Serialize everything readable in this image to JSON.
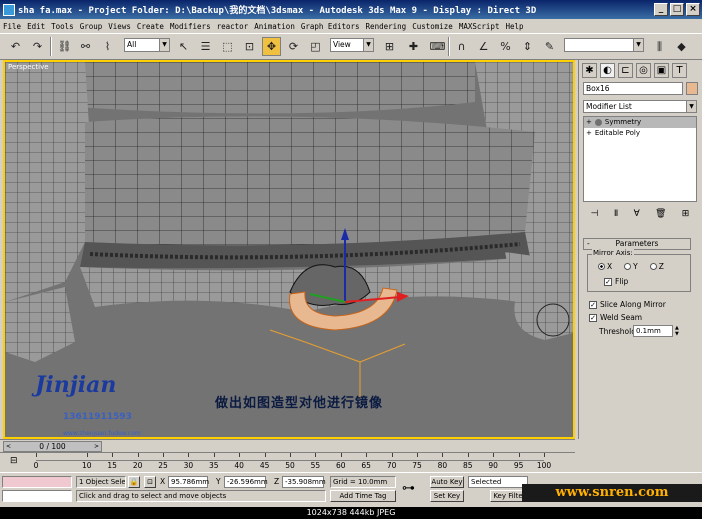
{
  "window": {
    "title": "sha fa.max    - Project Folder: D:\\Backup\\我的文档\\3dsmax    - Autodesk 3ds Max 9    - Display : Direct 3D"
  },
  "menu": [
    "File",
    "Edit",
    "Tools",
    "Group",
    "Views",
    "Create",
    "Modifiers",
    "reactor",
    "Animation",
    "Graph Editors",
    "Rendering",
    "Customize",
    "MAXScript",
    "Help"
  ],
  "toolbar": {
    "selection_filter": "All",
    "ref_coord": "View"
  },
  "viewport": {
    "label": "Perspective",
    "overlay_text": "做出如图造型对他进行镜像",
    "logo_text": "Jinjian",
    "logo_phone": "13611911593",
    "logo_url": "www.zhenjuan.fudew.com"
  },
  "command_panel": {
    "object_name": "Box16",
    "object_color": "#e8b890",
    "modifier_list_label": "Modifier List",
    "stack": [
      {
        "label": "Symmetry",
        "selected": true
      },
      {
        "label": "Editable Poly",
        "selected": false
      }
    ],
    "rollout_title": "Parameters",
    "mirror_axis_label": "Mirror Axis:",
    "axes": [
      {
        "label": "X",
        "checked": true
      },
      {
        "label": "Y",
        "checked": false
      },
      {
        "label": "Z",
        "checked": false
      }
    ],
    "flip_label": "Flip",
    "flip_checked": true,
    "slice_label": "Slice Along Mirror",
    "slice_checked": true,
    "weld_label": "Weld Seam",
    "weld_checked": true,
    "threshold_label": "Threshold:",
    "threshold_value": "0.1mm"
  },
  "timeline": {
    "frame_display": "0 / 100",
    "ticks": [
      "0",
      "10",
      "15",
      "20",
      "25",
      "30",
      "35",
      "40",
      "45",
      "50",
      "55",
      "60",
      "65",
      "70",
      "75",
      "80",
      "85",
      "90",
      "95",
      "100"
    ]
  },
  "status": {
    "selection_count": "1 Object Sele",
    "prompt": "Click and drag to select and move objects",
    "x_label": "X",
    "x_value": "95.786mm",
    "y_label": "Y",
    "y_value": "-26.596mm",
    "z_label": "Z",
    "z_value": "-35.908mm",
    "grid": "Grid = 10.0mm",
    "add_time_tag": "Add Time Tag",
    "auto_key": "Auto Key",
    "set_key": "Set Key",
    "key_mode": "Selected",
    "key_filters": "Key Filte"
  },
  "banner": "www.snren.com",
  "info_bar": "1024x738  444kb  JPEG"
}
